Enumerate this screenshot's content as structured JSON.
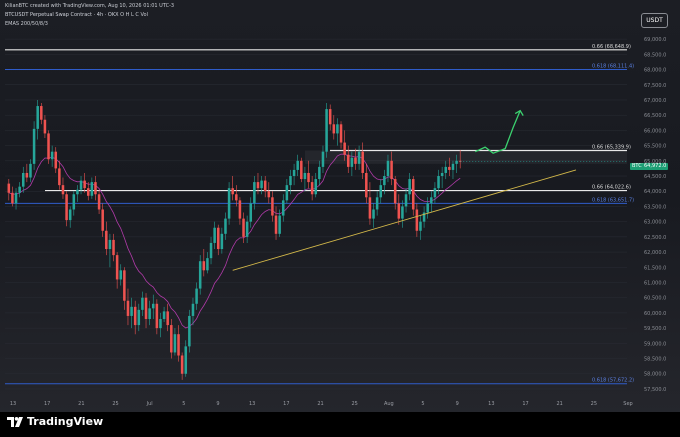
{
  "header": {
    "line1": "KilianBTC created with TradingView.com, Aug 10, 2026 01:01 UTC-3",
    "symbol": "BTCUSDT Perpetual Swap Contract · 4h · OKX",
    "ohlc": {
      "o": "O",
      "h": "H",
      "l": "L",
      "c": "C",
      "vol": "Vol"
    },
    "ema_label": "EMAS 200/50/8/3"
  },
  "currency_button": "USDT",
  "footer": {
    "brand": "TradingView"
  },
  "price_axis": {
    "ticks": [
      "69,000.0",
      "68,500.0",
      "68,000.0",
      "67,500.0",
      "67,000.0",
      "66,500.0",
      "66,000.0",
      "65,500.0",
      "65,000.0",
      "64,500.0",
      "64,000.0",
      "63,500.0",
      "63,000.0",
      "62,500.0",
      "62,000.0",
      "61,500.0",
      "61,000.0",
      "60,500.0",
      "60,000.0",
      "59,500.0",
      "59,000.0",
      "58,500.0",
      "58,000.0",
      "57,500.0"
    ],
    "current_price_label": "BTCUSDT.P",
    "current_price": "64,972.0"
  },
  "time_axis": {
    "ticks": [
      "13",
      "17",
      "21",
      "25",
      "Jul",
      "5",
      "9",
      "13",
      "17",
      "21",
      "25",
      "Aug",
      "5",
      "9",
      "13",
      "17",
      "21",
      "25",
      "Sep"
    ]
  },
  "chart_data": {
    "type": "candlestick",
    "ylim": [
      57400,
      69300
    ],
    "fib_levels": [
      {
        "label": "0.66 (68,648.9)",
        "value": 68648.9,
        "color": "#e8e8e8"
      },
      {
        "label": "0.618 (68,111.4)",
        "value": 68000,
        "color": "#2f5cc9"
      },
      {
        "label": "0.66 (65,339.9)",
        "value": 65339.9,
        "color": "#e8e8e8"
      },
      {
        "label": "0.66 (64,022.6)",
        "value": 64022.6,
        "color": "#e8e8e8"
      },
      {
        "label": "0.618 (63,651.7)",
        "value": 63600,
        "color": "#2f5cc9"
      },
      {
        "label": "0.618 (57,672.2)",
        "value": 57672.2,
        "color": "#2f5cc9"
      }
    ],
    "trendline": {
      "from": [
        62,
        61400
      ],
      "to": [
        174,
        64700
      ],
      "color": "#d4b94a"
    },
    "current_price": 64972.0,
    "candles": [
      [
        64250,
        64400,
        63700,
        63950
      ],
      [
        63950,
        64150,
        63500,
        63600
      ],
      [
        63600,
        64100,
        63400,
        63950
      ],
      [
        63950,
        64300,
        63800,
        64150
      ],
      [
        64150,
        64800,
        63950,
        64600
      ],
      [
        64600,
        64900,
        64300,
        64450
      ],
      [
        64450,
        65050,
        64300,
        64900
      ],
      [
        64900,
        66300,
        64700,
        66050
      ],
      [
        66050,
        67000,
        65700,
        66800
      ],
      [
        66800,
        66900,
        66200,
        66350
      ],
      [
        66350,
        66500,
        65750,
        65900
      ],
      [
        65900,
        66000,
        64900,
        65050
      ],
      [
        65050,
        65500,
        64800,
        65300
      ],
      [
        65300,
        65450,
        64600,
        64750
      ],
      [
        64750,
        65000,
        64050,
        64200
      ],
      [
        64200,
        64450,
        63750,
        63900
      ],
      [
        63900,
        64000,
        62850,
        63050
      ],
      [
        63050,
        63500,
        62800,
        63400
      ],
      [
        63400,
        64000,
        63200,
        63900
      ],
      [
        63900,
        64200,
        63650,
        64050
      ],
      [
        64050,
        64500,
        63900,
        64350
      ],
      [
        64350,
        64600,
        63950,
        64100
      ],
      [
        64100,
        64300,
        63700,
        63850
      ],
      [
        63850,
        64450,
        63750,
        64300
      ],
      [
        64300,
        64500,
        63700,
        63900
      ],
      [
        63900,
        64050,
        63250,
        63400
      ],
      [
        63400,
        63600,
        62500,
        62700
      ],
      [
        62700,
        63000,
        61900,
        62100
      ],
      [
        62100,
        62600,
        61500,
        62400
      ],
      [
        62400,
        62600,
        61700,
        61900
      ],
      [
        61900,
        62000,
        60800,
        61100
      ],
      [
        61100,
        61600,
        60900,
        61400
      ],
      [
        61400,
        61500,
        60100,
        60400
      ],
      [
        60400,
        60800,
        59600,
        59900
      ],
      [
        59900,
        60500,
        59500,
        60200
      ],
      [
        60200,
        60400,
        59300,
        59600
      ],
      [
        59600,
        60300,
        59400,
        60100
      ],
      [
        60100,
        60700,
        59900,
        60500
      ],
      [
        60500,
        60650,
        59500,
        59800
      ],
      [
        59800,
        60400,
        59600,
        60150
      ],
      [
        60150,
        60600,
        59800,
        60300
      ],
      [
        60300,
        60450,
        59300,
        59500
      ],
      [
        59500,
        60000,
        59200,
        59800
      ],
      [
        59800,
        60200,
        59700,
        60050
      ],
      [
        60050,
        60300,
        59400,
        59600
      ],
      [
        59600,
        59800,
        58500,
        58700
      ],
      [
        58700,
        59500,
        58600,
        59300
      ],
      [
        59300,
        59600,
        58400,
        58600
      ],
      [
        58600,
        58700,
        57800,
        58000
      ],
      [
        58000,
        59100,
        57900,
        58900
      ],
      [
        58900,
        60100,
        58700,
        59900
      ],
      [
        59900,
        60500,
        59600,
        60300
      ],
      [
        60300,
        61000,
        60100,
        60800
      ],
      [
        60800,
        61900,
        60600,
        61700
      ],
      [
        61700,
        62100,
        61200,
        61400
      ],
      [
        61400,
        62000,
        61300,
        61800
      ],
      [
        61800,
        62500,
        61600,
        62300
      ],
      [
        62300,
        63000,
        62100,
        62800
      ],
      [
        62800,
        62900,
        61900,
        62100
      ],
      [
        62100,
        62800,
        61950,
        62600
      ],
      [
        62600,
        63300,
        62400,
        63100
      ],
      [
        63100,
        64300,
        62900,
        64100
      ],
      [
        64100,
        64500,
        63700,
        63900
      ],
      [
        63900,
        64200,
        63500,
        63700
      ],
      [
        63700,
        63800,
        62900,
        63100
      ],
      [
        63100,
        63300,
        62300,
        62500
      ],
      [
        62500,
        63200,
        62300,
        63000
      ],
      [
        63000,
        63800,
        62800,
        63600
      ],
      [
        63600,
        64500,
        63400,
        64300
      ],
      [
        64300,
        64600,
        63900,
        64100
      ],
      [
        64100,
        64500,
        63900,
        64350
      ],
      [
        64350,
        64500,
        63800,
        64000
      ],
      [
        64000,
        64300,
        63600,
        63800
      ],
      [
        63800,
        64000,
        63000,
        63200
      ],
      [
        63200,
        63500,
        62400,
        62600
      ],
      [
        62600,
        63400,
        62500,
        63200
      ],
      [
        63200,
        63900,
        63000,
        63700
      ],
      [
        63700,
        64400,
        63600,
        64200
      ],
      [
        64200,
        64700,
        63900,
        64500
      ],
      [
        64500,
        64900,
        64200,
        64700
      ],
      [
        64700,
        65200,
        64500,
        65000
      ],
      [
        65000,
        65100,
        64300,
        64400
      ],
      [
        64400,
        64800,
        64000,
        64600
      ],
      [
        64600,
        65000,
        64100,
        64300
      ],
      [
        64300,
        64500,
        63700,
        63900
      ],
      [
        63900,
        64600,
        63800,
        64400
      ],
      [
        64400,
        65000,
        64200,
        64800
      ],
      [
        64800,
        65500,
        64600,
        65300
      ],
      [
        65300,
        66900,
        65100,
        66700
      ],
      [
        66700,
        66850,
        66000,
        66200
      ],
      [
        66200,
        66500,
        65700,
        65900
      ],
      [
        65900,
        66400,
        65500,
        66200
      ],
      [
        66200,
        66300,
        65400,
        65600
      ],
      [
        65600,
        66000,
        65000,
        65200
      ],
      [
        65200,
        65500,
        64600,
        64800
      ],
      [
        64800,
        65300,
        64500,
        65100
      ],
      [
        65100,
        65400,
        64700,
        64900
      ],
      [
        64900,
        65500,
        64700,
        65300
      ],
      [
        65300,
        65600,
        64400,
        64600
      ],
      [
        64600,
        64900,
        63600,
        63800
      ],
      [
        63800,
        64300,
        62900,
        63100
      ],
      [
        63100,
        63600,
        62800,
        63400
      ],
      [
        63400,
        64000,
        63200,
        63800
      ],
      [
        63800,
        64400,
        63600,
        64200
      ],
      [
        64200,
        64700,
        63900,
        64500
      ],
      [
        64500,
        65200,
        64300,
        65000
      ],
      [
        65000,
        65300,
        64200,
        64400
      ],
      [
        64400,
        64500,
        63400,
        63600
      ],
      [
        63600,
        63900,
        62900,
        63100
      ],
      [
        63100,
        63700,
        62800,
        63500
      ],
      [
        63500,
        64100,
        63300,
        63900
      ],
      [
        63900,
        64600,
        63700,
        64400
      ],
      [
        64400,
        64500,
        63200,
        63400
      ],
      [
        63400,
        63600,
        62500,
        62700
      ],
      [
        62700,
        63200,
        62400,
        63000
      ],
      [
        63000,
        63500,
        62800,
        63300
      ],
      [
        63300,
        63800,
        63100,
        63600
      ],
      [
        63600,
        64000,
        63300,
        63800
      ],
      [
        63800,
        64300,
        63600,
        64100
      ],
      [
        64100,
        64700,
        63900,
        64500
      ],
      [
        64500,
        64800,
        64100,
        64600
      ],
      [
        64600,
        65000,
        64400,
        64800
      ],
      [
        64800,
        65100,
        64500,
        64700
      ],
      [
        64700,
        65000,
        64400,
        64900
      ],
      [
        64900,
        65200,
        64600,
        65000
      ],
      [
        65000,
        65350,
        64750,
        64972
      ]
    ],
    "projection_arrow": {
      "color": "#3bd16f"
    }
  }
}
